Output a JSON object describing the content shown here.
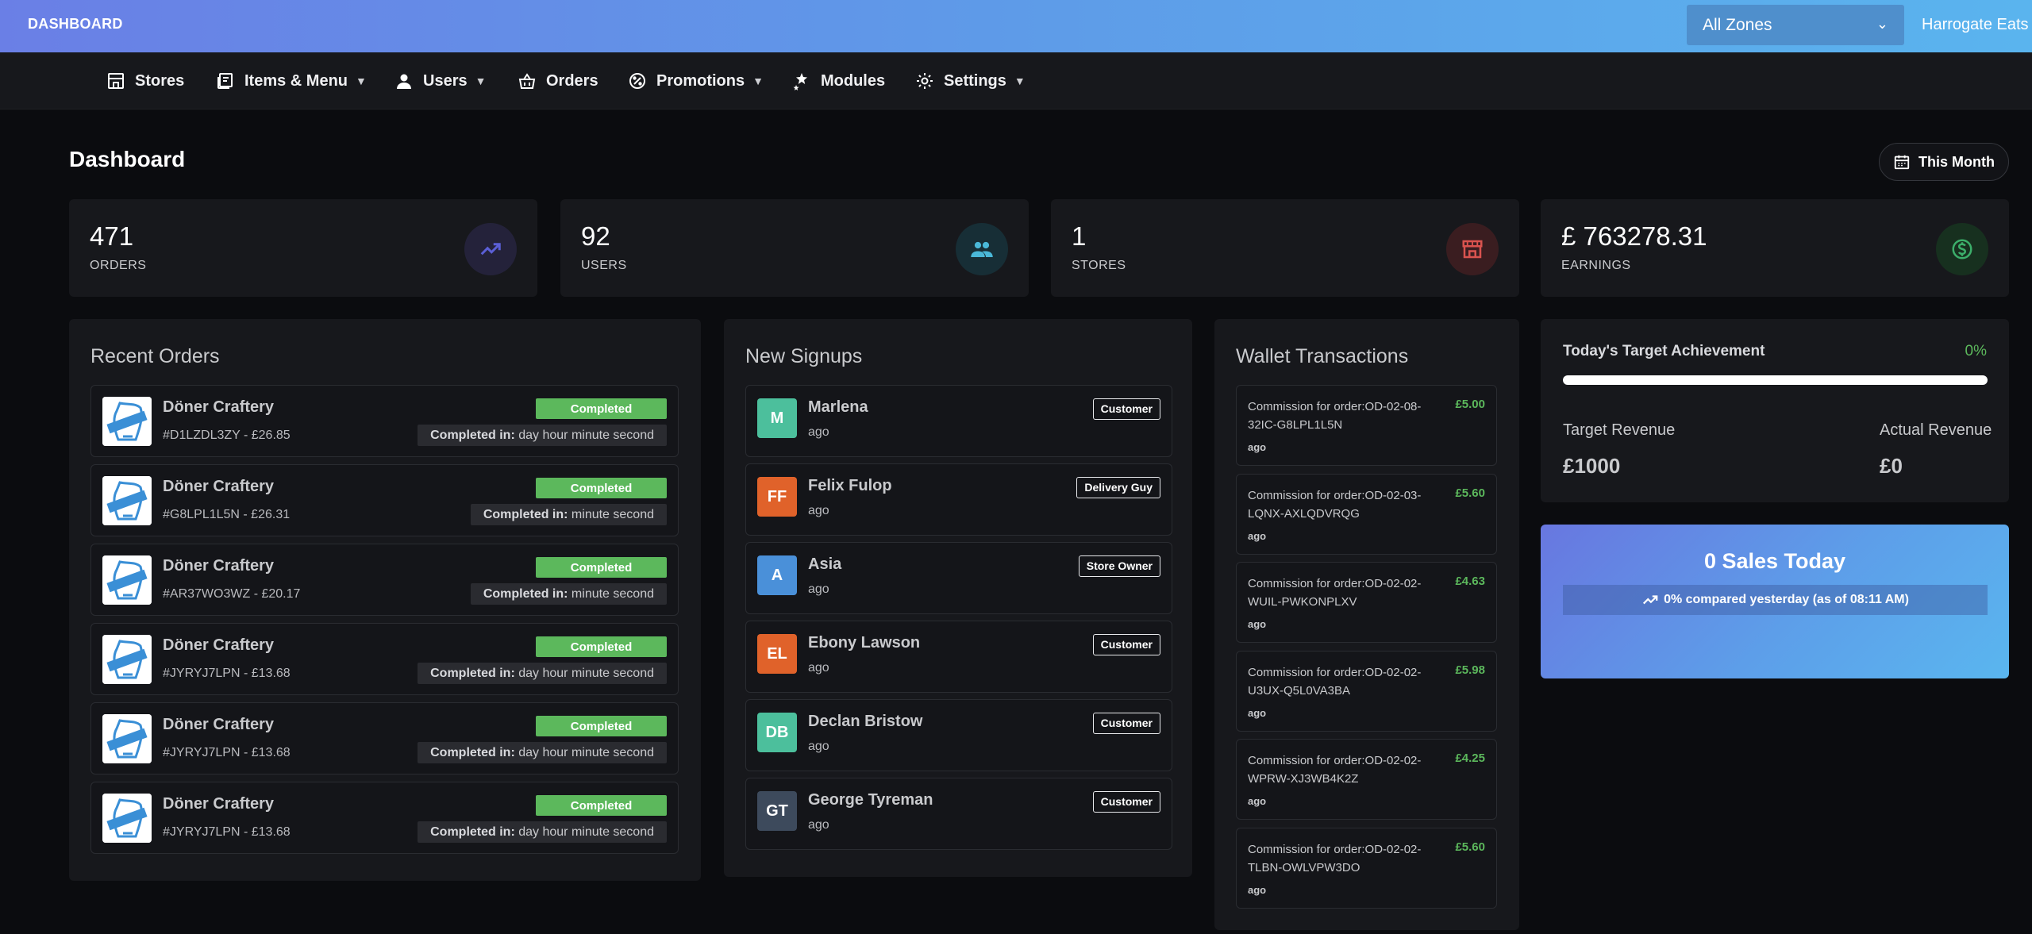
{
  "topbar": {
    "brand": "DASHBOARD",
    "zone_selected": "All Zones",
    "store_name": "Harrogate Eats"
  },
  "nav": [
    {
      "label": "Stores",
      "icon": "store-icon",
      "dropdown": false
    },
    {
      "label": "Items & Menu",
      "icon": "menu-book-icon",
      "dropdown": true
    },
    {
      "label": "Users",
      "icon": "user-icon",
      "dropdown": true
    },
    {
      "label": "Orders",
      "icon": "basket-icon",
      "dropdown": false
    },
    {
      "label": "Promotions",
      "icon": "percent-badge-icon",
      "dropdown": true
    },
    {
      "label": "Modules",
      "icon": "stars-icon",
      "dropdown": false
    },
    {
      "label": "Settings",
      "icon": "gear-icon",
      "dropdown": true
    }
  ],
  "page": {
    "title": "Dashboard",
    "period_button": "This Month"
  },
  "stats": [
    {
      "value": "471",
      "label": "ORDERS",
      "icon": "trend-up-icon",
      "color": "#5b5fd6"
    },
    {
      "value": "92",
      "label": "USERS",
      "icon": "users-icon",
      "color": "#4ab8d8"
    },
    {
      "value": "1",
      "label": "STORES",
      "icon": "shop-icon",
      "color": "#d9534f"
    },
    {
      "value": "£ 763278.31",
      "label": "EARNINGS",
      "icon": "dollar-circle-icon",
      "color": "#3cae6a"
    }
  ],
  "recent_orders": {
    "title": "Recent Orders",
    "time_prefix": "Completed in:",
    "items": [
      {
        "store": "Döner Craftery",
        "id": "#D1LZDL3ZY - £26.85",
        "status": "Completed",
        "time": " day hour minute second"
      },
      {
        "store": "Döner Craftery",
        "id": "#G8LPL1L5N - £26.31",
        "status": "Completed",
        "time": " minute second"
      },
      {
        "store": "Döner Craftery",
        "id": "#AR37WO3WZ - £20.17",
        "status": "Completed",
        "time": " minute second"
      },
      {
        "store": "Döner Craftery",
        "id": "#JYRYJ7LPN - £13.68",
        "status": "Completed",
        "time": " day hour minute second"
      },
      {
        "store": "Döner Craftery",
        "id": "#JYRYJ7LPN - £13.68",
        "status": "Completed",
        "time": " day hour minute second"
      },
      {
        "store": "Döner Craftery",
        "id": "#JYRYJ7LPN - £13.68",
        "status": "Completed",
        "time": " day hour minute second"
      }
    ]
  },
  "new_signups": {
    "title": "New Signups",
    "items": [
      {
        "initials": "M",
        "name": "Marlena",
        "ago": "ago",
        "role": "Customer",
        "color": "#4cbf9c"
      },
      {
        "initials": "FF",
        "name": "Felix Fulop",
        "ago": "ago",
        "role": "Delivery Guy",
        "color": "#e0622a"
      },
      {
        "initials": "A",
        "name": "Asia",
        "ago": "ago",
        "role": "Store Owner",
        "color": "#4a90d9"
      },
      {
        "initials": "EL",
        "name": "Ebony Lawson",
        "ago": "ago",
        "role": "Customer",
        "color": "#e0622a"
      },
      {
        "initials": "DB",
        "name": "Declan Bristow",
        "ago": "ago",
        "role": "Customer",
        "color": "#4cbf9c"
      },
      {
        "initials": "GT",
        "name": "George Tyreman",
        "ago": "ago",
        "role": "Customer",
        "color": "#3d4a5c"
      }
    ]
  },
  "wallet": {
    "title": "Wallet Transactions",
    "items": [
      {
        "desc": "Commission for order:OD-02-08-32IC-G8LPL1L5N",
        "amount": "£5.00",
        "ago": "ago"
      },
      {
        "desc": "Commission for order:OD-02-03-LQNX-AXLQDVRQG",
        "amount": "£5.60",
        "ago": "ago"
      },
      {
        "desc": "Commission for order:OD-02-02-WUIL-PWKONPLXV",
        "amount": "£4.63",
        "ago": "ago"
      },
      {
        "desc": "Commission for order:OD-02-02-U3UX-Q5L0VA3BA",
        "amount": "£5.98",
        "ago": "ago"
      },
      {
        "desc": "Commission for order:OD-02-02-WPRW-XJ3WB4K2Z",
        "amount": "£4.25",
        "ago": "ago"
      },
      {
        "desc": "Commission for order:OD-02-02-TLBN-OWLVPW3DO",
        "amount": "£5.60",
        "ago": "ago"
      }
    ]
  },
  "target": {
    "title": "Today's Target Achievement",
    "percent": "0%",
    "progress_fraction": 0,
    "target_label": "Target Revenue",
    "target_value": "£1000",
    "actual_label": "Actual Revenue",
    "actual_value": "£0"
  },
  "sales": {
    "title": "0 Sales Today",
    "compare": "0% compared yesterday (as of 08:11 AM)"
  }
}
